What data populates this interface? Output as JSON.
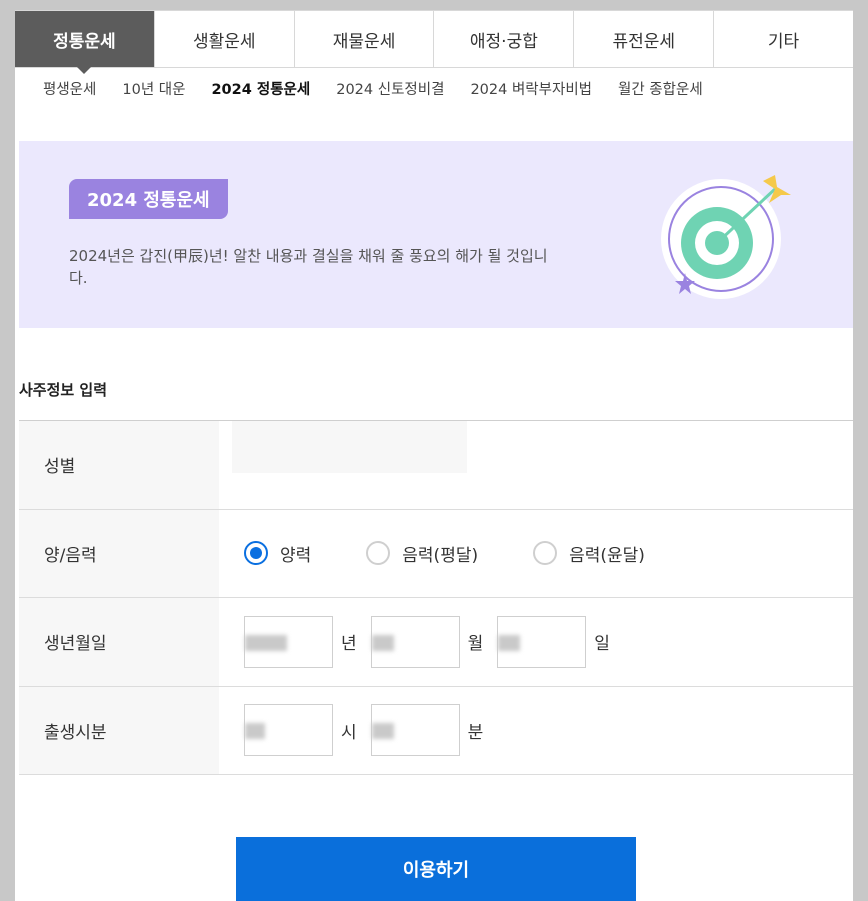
{
  "tabs": [
    {
      "label": "정통운세",
      "active": true
    },
    {
      "label": "생활운세",
      "active": false
    },
    {
      "label": "재물운세",
      "active": false
    },
    {
      "label": "애정·궁합",
      "active": false
    },
    {
      "label": "퓨전운세",
      "active": false
    },
    {
      "label": "기타",
      "active": false
    }
  ],
  "subnav": [
    {
      "label": "평생운세"
    },
    {
      "label": "10년 대운"
    },
    {
      "label": "2024 정통운세",
      "current": true
    },
    {
      "label": "2024 신토정비결"
    },
    {
      "label": "2024 벼락부자비법"
    },
    {
      "label": "월간 종합운세"
    }
  ],
  "banner": {
    "badge": "2024 정통운세",
    "description": "2024년은 갑진(甲辰)년! 알찬 내용과 결실을 채워 줄 풍요의 해가 될 것입니다.",
    "icon": "target-arrow-icon",
    "background": "#ebe8fd",
    "badge_color": "#9a83e0"
  },
  "section_title": "사주정보 입력",
  "form": {
    "gender_label": "성별",
    "calendar_label": "양/음력",
    "calendar_options": [
      {
        "label": "양력",
        "checked": true
      },
      {
        "label": "음력(평달)",
        "checked": false
      },
      {
        "label": "음력(윤달)",
        "checked": false
      }
    ],
    "birthdate_label": "생년월일",
    "year_unit": "년",
    "month_unit": "월",
    "day_unit": "일",
    "birthtime_label": "출생시분",
    "hour_unit": "시",
    "minute_unit": "분"
  },
  "submit_label": "이용하기",
  "accent_color": "#0a6fdb"
}
